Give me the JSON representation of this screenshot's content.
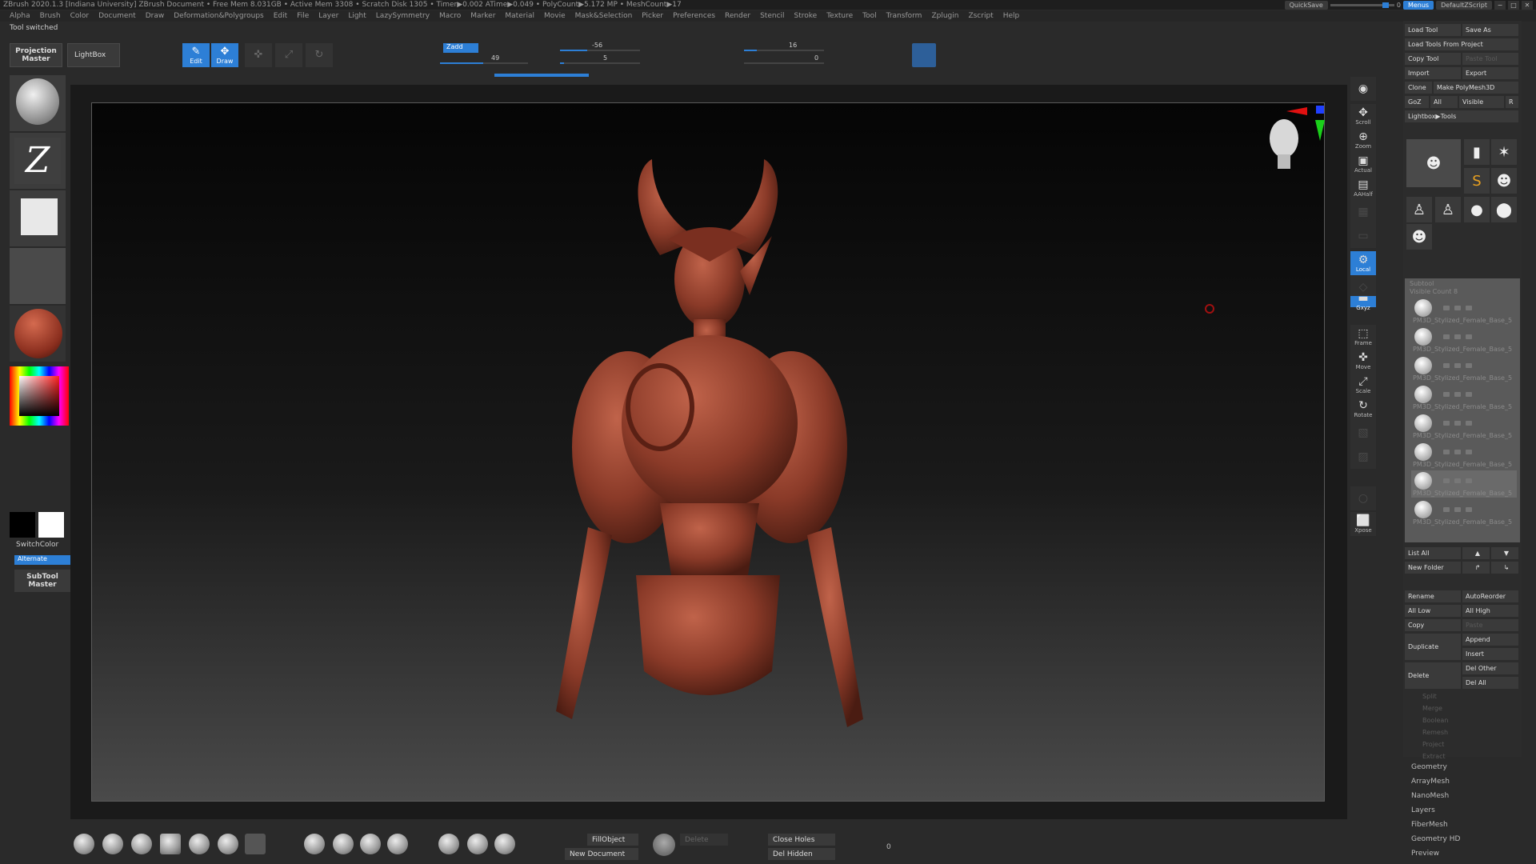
{
  "window": {
    "title": "ZBrush 2020.1.3 [Indiana University]   ZBrush Document      • Free Mem 8.031GB • Active Mem 3308 • Scratch Disk 1305 • Timer▶0.002 ATime▶0.049 • PolyCount▶5.172 MP • MeshCount▶17",
    "quicksave": "QuickSave",
    "quicksave_value": "0",
    "menus_label": "Menus",
    "script_label": "DefaultZScript",
    "controls": [
      "−",
      "□",
      "✕"
    ]
  },
  "menubar": [
    "Alpha",
    "Brush",
    "Color",
    "Document",
    "Draw",
    "Deformation&Polygroups",
    "Edit",
    "File",
    "Layer",
    "Light",
    "LazySymmetry",
    "Macro",
    "Marker",
    "Material",
    "Movie",
    "Mask&Selection",
    "Picker",
    "Preferences",
    "Render",
    "Stencil",
    "Stroke",
    "Texture",
    "Tool",
    "Transform",
    "Zplugin",
    "Zscript",
    "Help"
  ],
  "status": "Tool switched",
  "topbar": {
    "projection_master": "Projection\nMaster",
    "lightbox": "LightBox",
    "edit_label": "Edit",
    "draw_label": "Draw",
    "zadd": "Zadd",
    "slider_a_value": "-56",
    "slider_b_value": "16",
    "slider_c_value": "49",
    "slider_d_value": "5",
    "slider_e_value": "0"
  },
  "leftpanel": {
    "switch_color": "SwitchColor",
    "alternate": "Alternate",
    "subtool_master": "SubTool\nMaster"
  },
  "rightnav": [
    {
      "name": "bpr",
      "label": "",
      "icon": "◉",
      "state": "normal"
    },
    {
      "name": "scroll",
      "label": "Scroll",
      "icon": "✥",
      "state": "normal"
    },
    {
      "name": "zoom",
      "label": "Zoom",
      "icon": "⊕",
      "state": "normal"
    },
    {
      "name": "actual",
      "label": "Actual",
      "icon": "▣",
      "state": "normal"
    },
    {
      "name": "aahalf",
      "label": "AAHalf",
      "icon": "▤",
      "state": "normal"
    },
    {
      "name": "persp",
      "label": "",
      "icon": "▦",
      "state": "dim"
    },
    {
      "name": "floor",
      "label": "",
      "icon": "▭",
      "state": "dim"
    },
    {
      "name": "local",
      "label": "Local",
      "icon": "⚙",
      "state": "blue"
    },
    {
      "name": "lsym",
      "label": "",
      "icon": "◇",
      "state": "dim"
    },
    {
      "name": "gxyz",
      "label": "Gxyz",
      "icon": "▬",
      "state": "blue"
    },
    {
      "name": "frame",
      "label": "Frame",
      "icon": "⬚",
      "state": "normal"
    },
    {
      "name": "move",
      "label": "Move",
      "icon": "✜",
      "state": "normal"
    },
    {
      "name": "scale",
      "label": "Scale",
      "icon": "⤢",
      "state": "normal"
    },
    {
      "name": "rotate",
      "label": "Rotate",
      "icon": "↻",
      "state": "normal"
    },
    {
      "name": "polyf",
      "label": "",
      "icon": "▧",
      "state": "dim"
    },
    {
      "name": "transp",
      "label": "",
      "icon": "▨",
      "state": "dim"
    },
    {
      "name": "ghost",
      "label": "",
      "icon": "○",
      "state": "dim"
    },
    {
      "name": "xpose",
      "label": "Xpose",
      "icon": "⬜",
      "state": "normal"
    }
  ],
  "toolpanel": {
    "load_tool": "Load Tool",
    "save_as": "Save As",
    "load_from_project": "Load Tools From Project",
    "copy_tool": "Copy Tool",
    "paste_tool": "Paste Tool",
    "import": "Import",
    "export": "Export",
    "clone": "Clone",
    "make_polymesh": "Make PolyMesh3D",
    "goz": "GoZ",
    "all": "All",
    "visible": "Visible",
    "r": "R",
    "lightbox_tools": "Lightbox▶Tools",
    "subtool_title": "Subtool",
    "visible_count": "Visible Count 8",
    "subtool_name": "PM3D_Stylized_Female_Base_5",
    "list_all": "List All",
    "new_folder": "New Folder",
    "rename": "Rename",
    "autoreorder": "AutoReorder",
    "all_low": "All Low",
    "all_high": "All High",
    "copy": "Copy",
    "paste": "Paste",
    "duplicate": "Duplicate",
    "append": "Append",
    "insert": "Insert",
    "delete": "Delete",
    "del_other": "Del Other",
    "del_all": "Del All",
    "dim_list": [
      "Split",
      "Merge",
      "Boolean",
      "Remesh",
      "Project",
      "Extract"
    ],
    "sub_list": [
      "Geometry",
      "ArrayMesh",
      "NanoMesh",
      "Layers",
      "FiberMesh",
      "Geometry HD",
      "Preview"
    ]
  },
  "bottombar": {
    "fill_object": "FillObject",
    "new_document": "New Document",
    "delete": "Delete",
    "close_holes": "Close Holes",
    "del_hidden": "Del Hidden",
    "value": "0"
  }
}
